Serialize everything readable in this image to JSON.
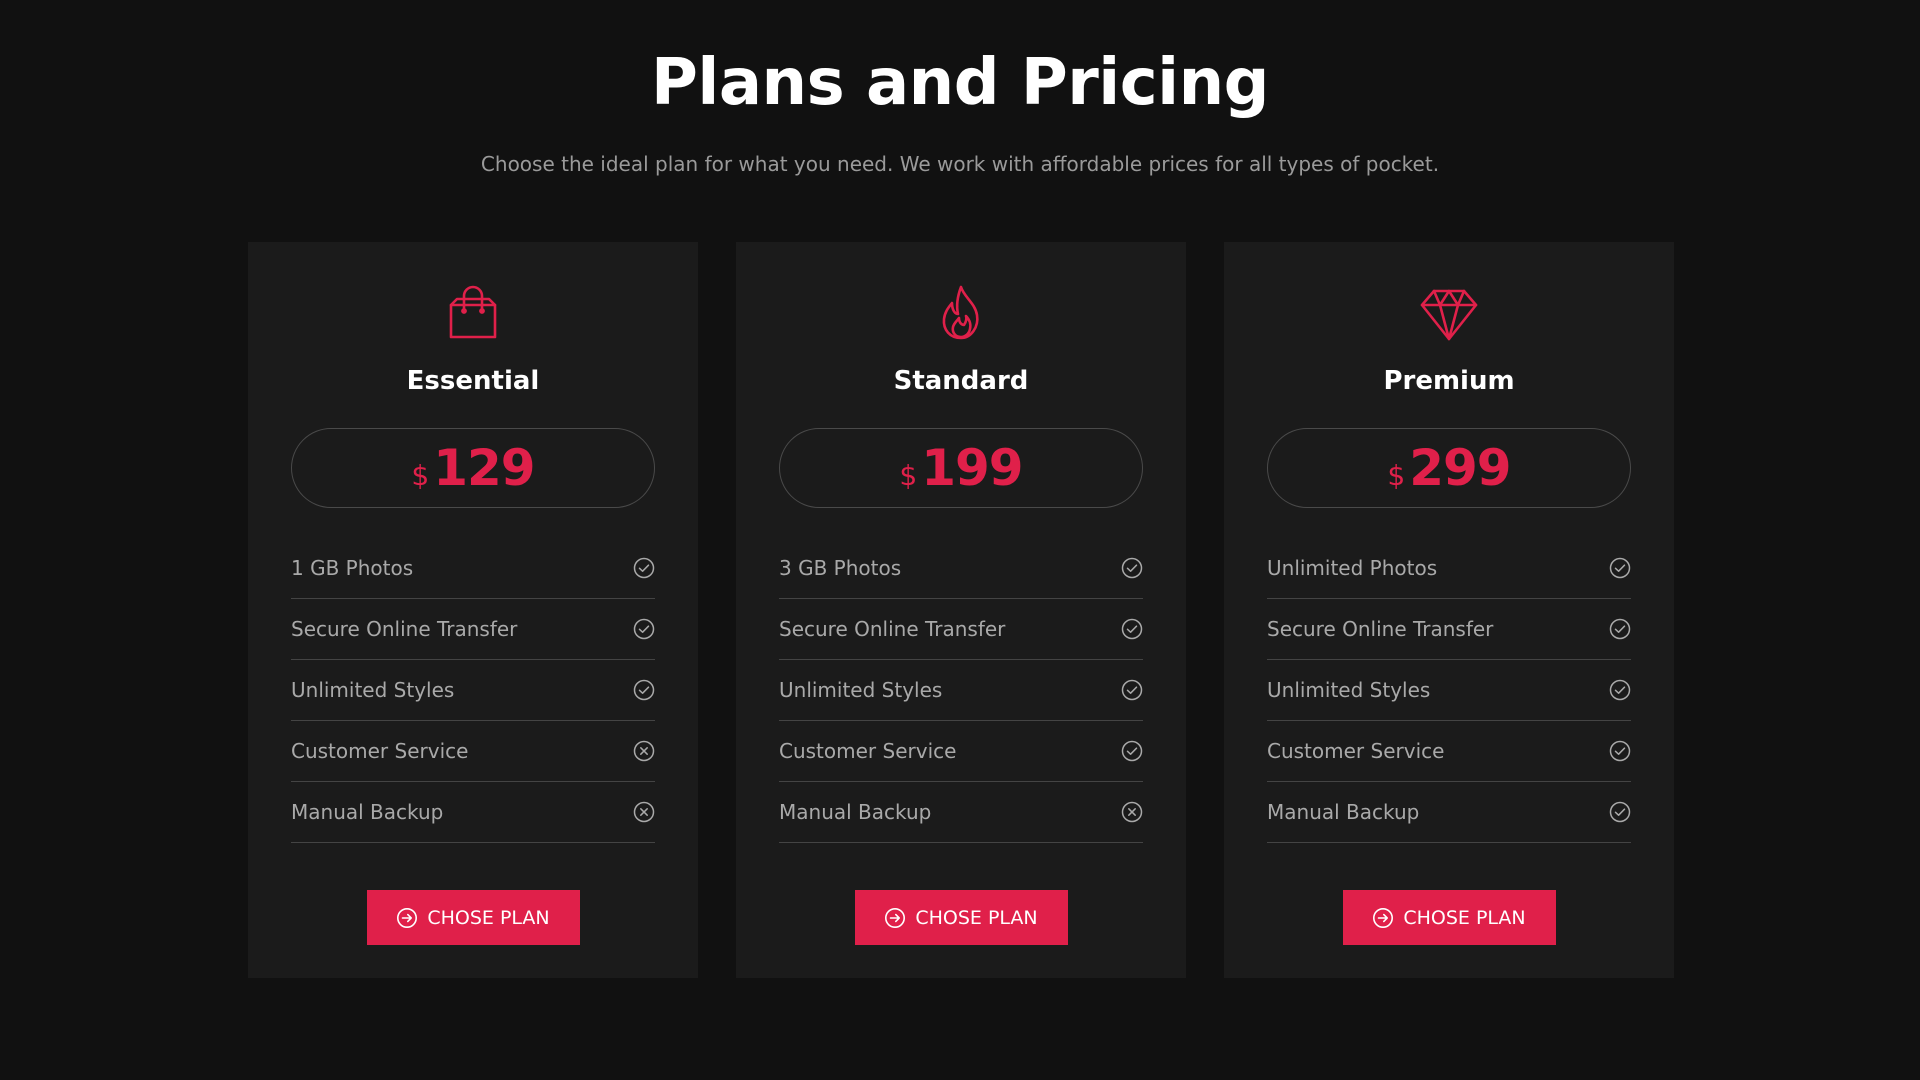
{
  "header": {
    "title": "Plans and Pricing",
    "subtitle": "Choose the ideal plan for what you need. We work with affordable prices for all types of pocket."
  },
  "colors": {
    "background": "#111111",
    "card": "#1b1b1b",
    "accent": "#e0204a",
    "muted_text": "#a9a9a9",
    "divider": "#444444"
  },
  "plans": [
    {
      "name": "Essential",
      "icon": "shopping-bag-icon",
      "currency": "$",
      "price": "129",
      "features": [
        {
          "label": "1 GB Photos",
          "included": true
        },
        {
          "label": "Secure Online Transfer",
          "included": true
        },
        {
          "label": "Unlimited Styles",
          "included": true
        },
        {
          "label": "Customer Service",
          "included": false
        },
        {
          "label": "Manual Backup",
          "included": false
        }
      ],
      "cta_label": "CHOSE PLAN"
    },
    {
      "name": "Standard",
      "icon": "fire-icon",
      "currency": "$",
      "price": "199",
      "features": [
        {
          "label": "3 GB Photos",
          "included": true
        },
        {
          "label": "Secure Online Transfer",
          "included": true
        },
        {
          "label": "Unlimited Styles",
          "included": true
        },
        {
          "label": "Customer Service",
          "included": true
        },
        {
          "label": "Manual Backup",
          "included": false
        }
      ],
      "cta_label": "CHOSE PLAN"
    },
    {
      "name": "Premium",
      "icon": "diamond-icon",
      "currency": "$",
      "price": "299",
      "features": [
        {
          "label": "Unlimited Photos",
          "included": true
        },
        {
          "label": "Secure Online Transfer",
          "included": true
        },
        {
          "label": "Unlimited Styles",
          "included": true
        },
        {
          "label": "Customer Service",
          "included": true
        },
        {
          "label": "Manual Backup",
          "included": true
        }
      ],
      "cta_label": "CHOSE PLAN"
    }
  ]
}
